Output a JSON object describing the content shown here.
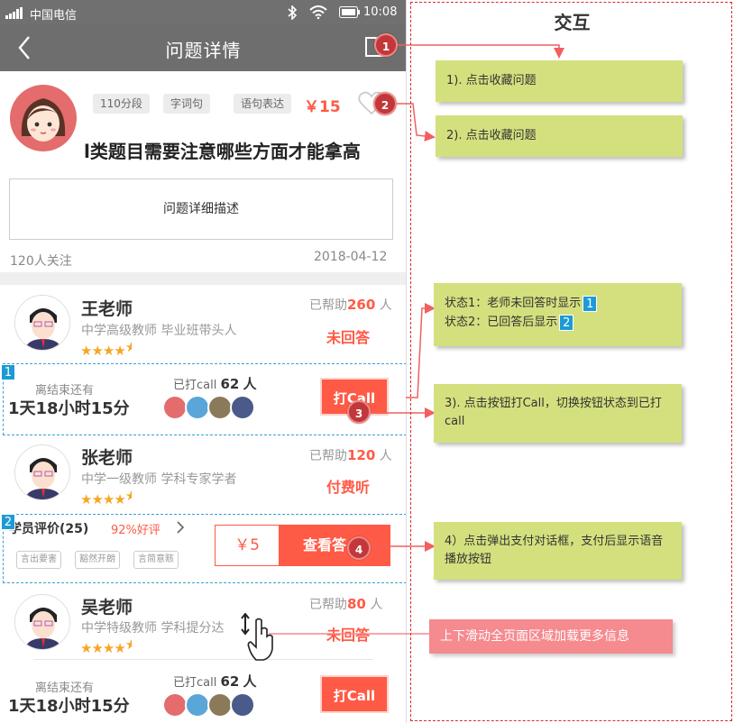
{
  "status_bar": {
    "carrier": "中国电信",
    "time": "10:08"
  },
  "nav": {
    "title": "问题详情",
    "back_icon": "back-chevron-icon",
    "favorite_icon": "bookmark-icon"
  },
  "question": {
    "tags": [
      "110分段",
      "字词句",
      "语句表达"
    ],
    "reward": "￥15",
    "title": "l类题目需要注意哪些方面才能拿高",
    "description": "问题详细描述",
    "followers": "120人关注",
    "date": "2018-04-12"
  },
  "teachers": [
    {
      "name": "王老师",
      "desc": "中学高级教师   毕业班带头人",
      "helped_prefix": "已帮助",
      "helped_count": "260",
      "helped_suffix": "人",
      "status": "未回答",
      "countdown_label": "离结束还有",
      "countdown": "1天18小时15分",
      "calls_prefix": "已打call",
      "calls_count": "62",
      "calls_suffix": "人",
      "button": "打Call",
      "rating": 4.5
    },
    {
      "name": "张老师",
      "desc": "中学一级教师   学科专家学者",
      "helped_prefix": "已帮助",
      "helped_count": "120",
      "helped_suffix": "人",
      "status": "付费听",
      "eval_title": "学员评价(25)",
      "eval_good": "92%好评",
      "eval_chips": [
        "言出要害",
        "豁然开朗",
        "言简意赅"
      ],
      "price": "￥5",
      "view_button": "查看答",
      "rating": 4.5
    },
    {
      "name": "吴老师",
      "desc": "中学特级教师   学科提分达",
      "helped_prefix": "已帮助",
      "helped_count": "80",
      "helped_suffix": "人",
      "status": "未回答",
      "countdown_label": "离结束还有",
      "countdown": "1天18小时15分",
      "calls_prefix": "已打call",
      "calls_count": "62",
      "calls_suffix": "人",
      "button": "打Call",
      "rating": 4.5
    }
  ],
  "markers": {
    "m1": "1",
    "m2": "2",
    "m3": "3",
    "m4": "4",
    "s1": "1",
    "s2": "2"
  },
  "panel": {
    "title": "交互",
    "note1": "1). 点击收藏问题",
    "note2": "2). 点击收藏问题",
    "state1": "状态1：老师未回答时显示",
    "state2": "状态2：已回答后显示",
    "note3": "3). 点击按钮打Call，切换按钮状态到已打call",
    "note4": "4）点击弹出支付对话框，支付后显示语音播放按钮",
    "note5": "上下滑动全页面区域加载更多信息"
  },
  "colors": {
    "accent": "#ff5a45",
    "note_green": "#d4e07e",
    "note_pink": "#f58a8f",
    "marker_red": "#c1373a",
    "marker_blue": "#1d9ad6",
    "dashed_red": "#d92b2b"
  }
}
